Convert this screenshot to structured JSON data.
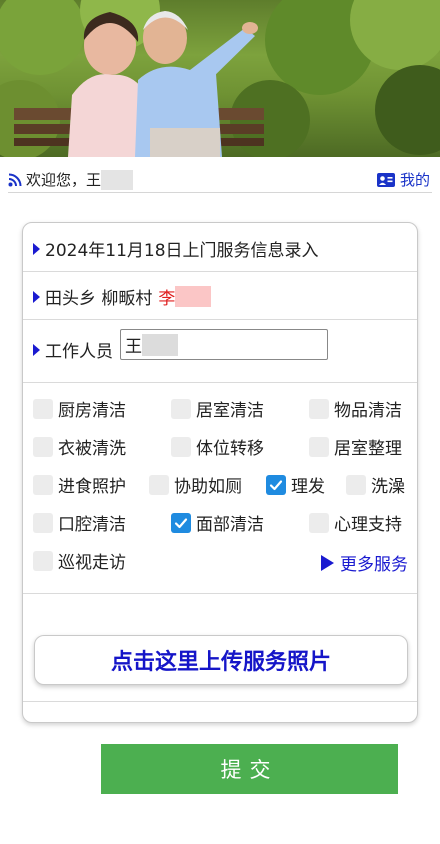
{
  "hero": {
    "image": "photo of elderly couple sitting on park bench"
  },
  "welcome": {
    "greeting": "欢迎您，王",
    "mine_label": "我的"
  },
  "form": {
    "title": "2024年11月18日上门服务信息录入",
    "location_prefix": "田头乡 柳畈村",
    "location_name": "李",
    "worker_label": "工作人员",
    "worker_value": "王"
  },
  "services": [
    {
      "label": "厨房清洁",
      "checked": false
    },
    {
      "label": "居室清洁",
      "checked": false
    },
    {
      "label": "物品清洁",
      "checked": false
    },
    {
      "label": "衣被清洗",
      "checked": false
    },
    {
      "label": "体位转移",
      "checked": false
    },
    {
      "label": "居室整理",
      "checked": false
    },
    {
      "label": "进食照护",
      "checked": false
    },
    {
      "label": "协助如厕",
      "checked": false
    },
    {
      "label": "理发",
      "checked": true
    },
    {
      "label": "洗澡",
      "checked": false
    },
    {
      "label": "口腔清洁",
      "checked": false
    },
    {
      "label": "面部清洁",
      "checked": true
    },
    {
      "label": "心理支持",
      "checked": false
    },
    {
      "label": "巡视走访",
      "checked": false
    }
  ],
  "more_services": "更多服务",
  "upload_label": "点击这里上传服务照片",
  "submit_label": "提交",
  "colors": {
    "link": "#1a33c8",
    "submit": "#4caf50",
    "checkbox_checked": "#1f8be0"
  }
}
